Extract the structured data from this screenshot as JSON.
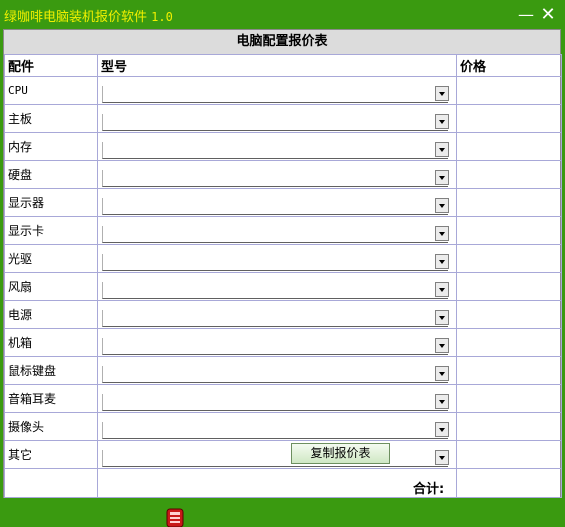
{
  "window": {
    "title": "绿咖啡电脑装机报价软件",
    "version": "1.0",
    "minimize_glyph": "—",
    "close_glyph": "✕"
  },
  "table": {
    "heading": "电脑配置报价表",
    "columns": {
      "part": "配件",
      "model": "型号",
      "price": "价格"
    },
    "rows": [
      {
        "part": "CPU",
        "model": "",
        "price": ""
      },
      {
        "part": "主板",
        "model": "",
        "price": ""
      },
      {
        "part": "内存",
        "model": "",
        "price": ""
      },
      {
        "part": "硬盘",
        "model": "",
        "price": ""
      },
      {
        "part": "显示器",
        "model": "",
        "price": ""
      },
      {
        "part": "显示卡",
        "model": "",
        "price": ""
      },
      {
        "part": "光驱",
        "model": "",
        "price": ""
      },
      {
        "part": "风扇",
        "model": "",
        "price": ""
      },
      {
        "part": "电源",
        "model": "",
        "price": ""
      },
      {
        "part": "机箱",
        "model": "",
        "price": ""
      },
      {
        "part": "鼠标键盘",
        "model": "",
        "price": ""
      },
      {
        "part": "音箱耳麦",
        "model": "",
        "price": ""
      },
      {
        "part": "摄像头",
        "model": "",
        "price": ""
      },
      {
        "part": "其它",
        "model": "",
        "price": ""
      }
    ]
  },
  "footer": {
    "copy_button": "复制报价表",
    "total_label": "合计:",
    "total_value": ""
  },
  "colors": {
    "window_green": "#3a9a10",
    "title_yellow": "#f0f000",
    "grid_line": "#a8a8d8",
    "header_bg": "#dcdcdc"
  },
  "icons": {
    "mascot": "red-robot-icon",
    "dropdown": "chevron-down-icon"
  }
}
